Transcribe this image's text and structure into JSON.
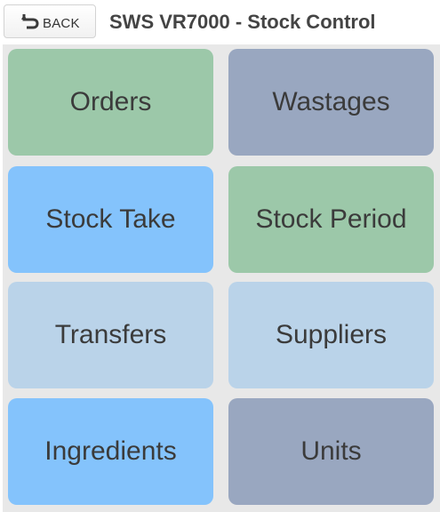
{
  "header": {
    "back_label": "BACK",
    "title": "SWS VR7000 - Stock Control",
    "back_icon": "undo-arrow-icon"
  },
  "tiles": [
    {
      "label": "Orders",
      "color": "#9cc8a9"
    },
    {
      "label": "Wastages",
      "color": "#99a7c0"
    },
    {
      "label": "Stock Take",
      "color": "#84c3fc"
    },
    {
      "label": "Stock Period",
      "color": "#9cc8a9"
    },
    {
      "label": "Transfers",
      "color": "#bad3e9"
    },
    {
      "label": "Suppliers",
      "color": "#bad3e9"
    },
    {
      "label": "Ingredients",
      "color": "#84c3fc"
    },
    {
      "label": "Units",
      "color": "#99a7c0"
    }
  ]
}
